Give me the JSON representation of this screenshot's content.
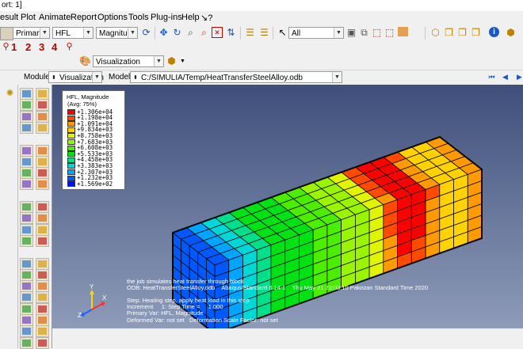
{
  "window": {
    "title_fragment": "ort: 1]"
  },
  "menu": [
    "esult",
    "Plot",
    "Animate",
    "Report",
    "Options",
    "Tools",
    "Plug-ins",
    "Help",
    "↘?"
  ],
  "toolbar": {
    "primary_select": "Primary",
    "variable_select": "HFL",
    "invariant_select": "Magnitude",
    "filter_select": "All"
  },
  "step_numbers": [
    "1",
    "2",
    "3",
    "4"
  ],
  "viz_defaults": "Visualization defaults",
  "context": {
    "module_label": "Module:",
    "module_value": "Visualization",
    "model_label": "Model:",
    "model_value": "C:/SIMULIA/Temp/HeatTransferSteelAlloy.odb"
  },
  "legend": {
    "title": "HFL, Magnitude",
    "subtitle": "(Avg: 75%)",
    "levels": [
      {
        "value": "+1.306e+04",
        "color": "#ff0000"
      },
      {
        "value": "+1.198e+04",
        "color": "#ff4a00"
      },
      {
        "value": "+1.091e+04",
        "color": "#ff9a00"
      },
      {
        "value": "+9.834e+03",
        "color": "#ffd200"
      },
      {
        "value": "+8.758e+03",
        "color": "#e2f500"
      },
      {
        "value": "+7.683e+03",
        "color": "#9cf500"
      },
      {
        "value": "+6.608e+03",
        "color": "#4cee00"
      },
      {
        "value": "+5.533e+03",
        "color": "#00e214"
      },
      {
        "value": "+4.458e+03",
        "color": "#00e08c"
      },
      {
        "value": "+3.383e+03",
        "color": "#00d7d7"
      },
      {
        "value": "+2.307e+03",
        "color": "#00a5ff"
      },
      {
        "value": "+1.232e+03",
        "color": "#0058ff"
      },
      {
        "value": "+1.569e+02",
        "color": "#0010ff"
      }
    ]
  },
  "info": [
    "the job simulates heat transfer through block",
    "ODB: HeatTransferSteelAlloy.odb    Abaqus/Standard 6.14-1    Thu May 21 23:03:10 Pakistan Standard Time 2020",
    "",
    "Step: Heating step, apply heat load in this step",
    "Increment     1: Step Time =     1.000",
    "Primary Var: HFL, Magnitude",
    "Deformed Var: not set   Deformation Scale Factor: not set"
  ],
  "triad": {
    "x": "X",
    "y": "Y",
    "z": "Z"
  },
  "colors": {
    "viewport_top": "#3e4f7a",
    "viewport_bottom": "#8e9bb9",
    "mesh_line": "#0a0a0a"
  }
}
